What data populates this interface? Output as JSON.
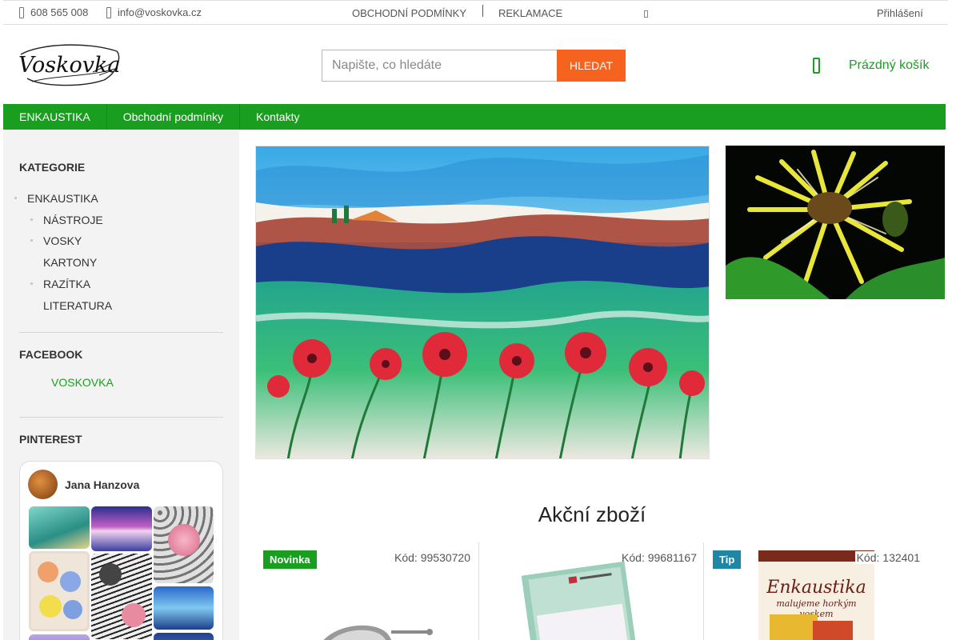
{
  "topbar": {
    "phone": "608 565 008",
    "email": "info@voskovka.cz",
    "terms": "OBCHODNÍ PODMÍNKY",
    "complaints": "REKLAMACE",
    "login": "Přihlášení"
  },
  "header": {
    "logo_text": "Voskovka",
    "search_placeholder": "Napište, co hledáte",
    "search_button": "HLEDAT",
    "cart_label": "Prázdný košík"
  },
  "nav": {
    "items": [
      "ENKAUSTIKA",
      "Obchodní podmínky",
      "Kontakty"
    ]
  },
  "sidebar": {
    "categories_title": "KATEGORIE",
    "categories": [
      {
        "label": "ENKAUSTIKA"
      },
      {
        "label": "NÁSTROJE"
      },
      {
        "label": "VOSKY"
      },
      {
        "label": "KARTONY"
      },
      {
        "label": "RAZÍTKA"
      },
      {
        "label": "LITERATURA"
      }
    ],
    "facebook_title": "FACEBOOK",
    "facebook_link": "VOSKOVKA",
    "pinterest_title": "PINTEREST",
    "pinterest_user": "Jana Hanzova"
  },
  "main": {
    "section_title": "Akční zboží",
    "products": [
      {
        "badge": "Novinka",
        "badge_color": "#1a9e1f",
        "code": "Kód: 99530720"
      },
      {
        "badge": "",
        "badge_color": "",
        "code": "Kód: 99681167"
      },
      {
        "badge": "Tip",
        "badge_color": "#1f86a5",
        "code": "Kód: 132401"
      }
    ]
  },
  "book_cover": {
    "title": "Enkaustika",
    "subtitle": "malujeme horkým voskem"
  },
  "colors": {
    "accent_green": "#1a9e1f",
    "search_orange": "#f5631f",
    "sidebar_bg": "#f3f3f3"
  }
}
